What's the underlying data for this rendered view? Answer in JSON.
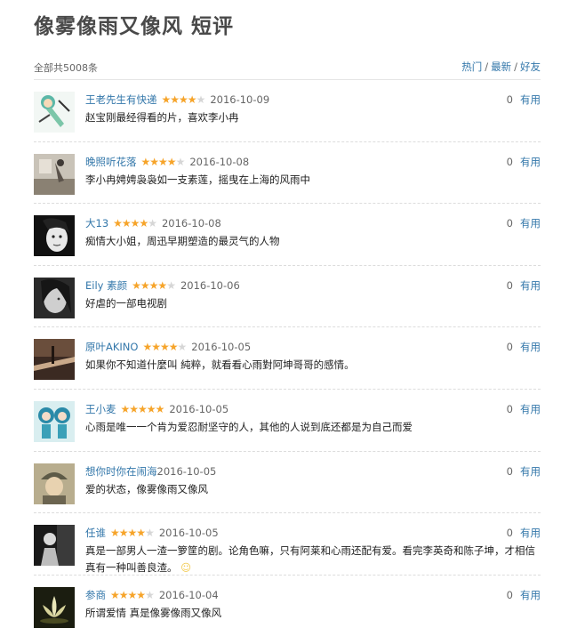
{
  "page": {
    "title": "像雾像雨又像风 短评"
  },
  "summary": {
    "total": "全部共5008条"
  },
  "sort": {
    "hot": "热门",
    "latest": "最新",
    "friends": "好友",
    "sep": "/"
  },
  "colors": {
    "link": "#3377aa",
    "star_on": "#f6a42a",
    "star_off": "#d6d6d6"
  },
  "useful_label": "有用",
  "comments": [
    {
      "user": "王老先生有快递",
      "rating": 4,
      "date": "2016-10-09",
      "votes": "0",
      "text": "赵宝刚最经得看的片，喜欢李小冉"
    },
    {
      "user": "晚照听花落",
      "rating": 4,
      "date": "2016-10-08",
      "votes": "0",
      "text": "李小冉娉娉袅袅如一支素莲，摇曳在上海的风雨中"
    },
    {
      "user": "大13",
      "rating": 4,
      "date": "2016-10-08",
      "votes": "0",
      "text": "痴情大小姐，周迅早期塑造的最灵气的人物"
    },
    {
      "user": "Eily 素颜",
      "rating": 4,
      "date": "2016-10-06",
      "votes": "0",
      "text": "好虐的一部电视剧"
    },
    {
      "user": "原叶AKINO",
      "rating": 4,
      "date": "2016-10-05",
      "votes": "0",
      "text": "如果你不知道什麼叫 純粹，就看看心雨對阿坤哥哥的感情。"
    },
    {
      "user": "王小麦",
      "rating": 5,
      "date": "2016-10-05",
      "votes": "0",
      "text": "心雨是唯一一个肯为爱忍耐坚守的人，其他的人说到底还都是为自己而爱"
    },
    {
      "user": "想你时你在闹海",
      "rating": 0,
      "date": "2016-10-05",
      "votes": "0",
      "text": "爱的状态，像雾像雨又像风"
    },
    {
      "user": "任谁",
      "rating": 4,
      "date": "2016-10-05",
      "votes": "0",
      "text": "真是一部男人一渣一箩筐的剧。论角色嘛，只有阿莱和心雨还配有爱。看完李英奇和陈子坤，才相信真有一种叫善良渣。",
      "emoji": "☺"
    },
    {
      "user": "参商",
      "rating": 4,
      "date": "2016-10-04",
      "votes": "0",
      "text": "所谓爱情 真是像雾像雨又像风"
    }
  ]
}
